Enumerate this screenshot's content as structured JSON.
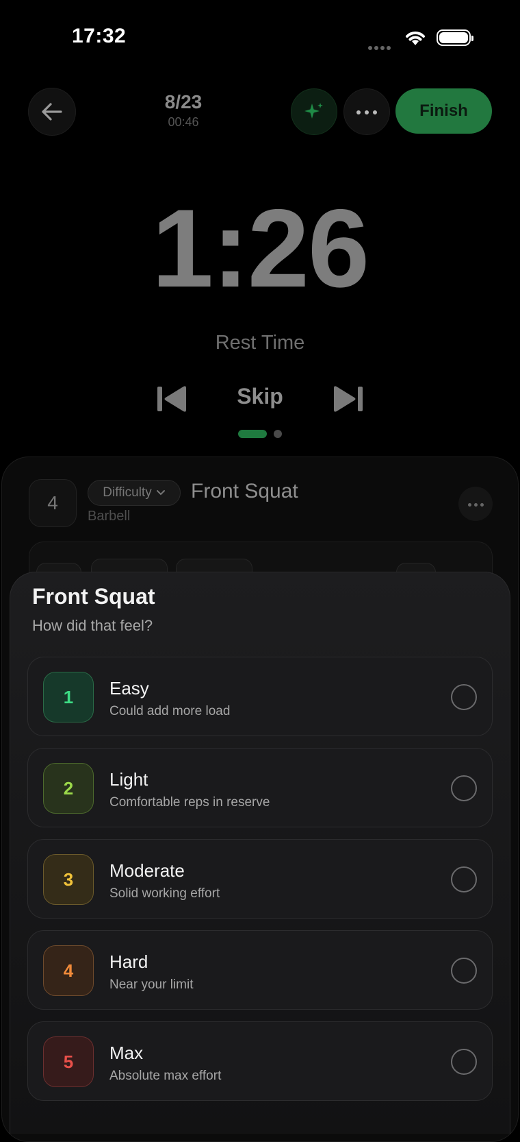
{
  "status_bar": {
    "time": "17:32"
  },
  "header": {
    "progress_count": "8/23",
    "elapsed": "00:46",
    "finish_label": "Finish"
  },
  "timer": {
    "value": "1:26",
    "label": "Rest Time",
    "skip_label": "Skip"
  },
  "exercise": {
    "number": "4",
    "difficulty_label": "Difficulty",
    "name": "Front Squat",
    "equipment": "Barbell"
  },
  "sheet": {
    "title": "Front Squat",
    "subtitle": "How did that feel?",
    "options": [
      {
        "value": "1",
        "title": "Easy",
        "desc": "Could add more load",
        "color": "#3ddc84",
        "bg": "#16392a",
        "border": "#2a6b47"
      },
      {
        "value": "2",
        "title": "Light",
        "desc": "Comfortable reps in reserve",
        "color": "#9bd84a",
        "bg": "#28331c",
        "border": "#4d6a2d"
      },
      {
        "value": "3",
        "title": "Moderate",
        "desc": "Solid working effort",
        "color": "#f0c23a",
        "bg": "#342c18",
        "border": "#6b5a2b"
      },
      {
        "value": "4",
        "title": "Hard",
        "desc": "Near your limit",
        "color": "#f08a3a",
        "bg": "#352418",
        "border": "#6e4a2c"
      },
      {
        "value": "5",
        "title": "Max",
        "desc": "Absolute max effort",
        "color": "#e8504a",
        "bg": "#361b1b",
        "border": "#6b2f2f"
      }
    ]
  }
}
